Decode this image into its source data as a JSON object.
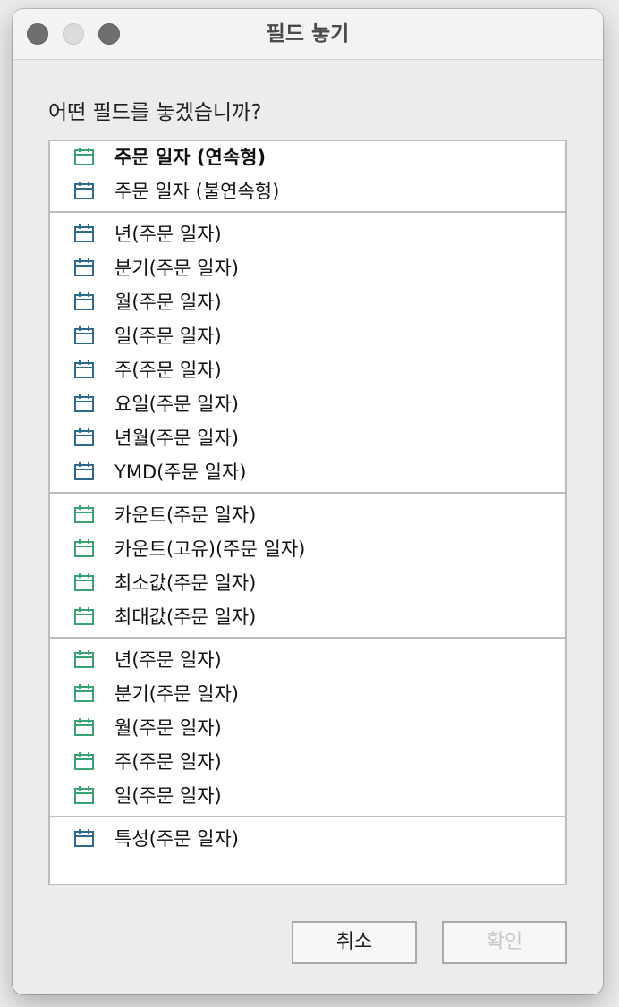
{
  "window": {
    "title": "필드 놓기"
  },
  "prompt": "어떤 필드를 놓겠습니까?",
  "colors": {
    "icon_blue": "#2c6a8e",
    "icon_green": "#3aa374"
  },
  "groups": [
    [
      {
        "label": "주문 일자 (연속형)",
        "icon": "calendar-icon",
        "color": "green",
        "bold": true
      },
      {
        "label": "주문 일자 (불연속형)",
        "icon": "calendar-icon",
        "color": "blue"
      }
    ],
    [
      {
        "label": "년(주문 일자)",
        "icon": "calendar-icon",
        "color": "blue"
      },
      {
        "label": "분기(주문 일자)",
        "icon": "calendar-icon",
        "color": "blue"
      },
      {
        "label": "월(주문 일자)",
        "icon": "calendar-icon",
        "color": "blue"
      },
      {
        "label": "일(주문 일자)",
        "icon": "calendar-icon",
        "color": "blue"
      },
      {
        "label": "주(주문 일자)",
        "icon": "calendar-icon",
        "color": "blue"
      },
      {
        "label": "요일(주문 일자)",
        "icon": "calendar-icon",
        "color": "blue"
      },
      {
        "label": "년월(주문 일자)",
        "icon": "calendar-icon",
        "color": "blue"
      },
      {
        "label": "YMD(주문 일자)",
        "icon": "calendar-icon",
        "color": "blue"
      }
    ],
    [
      {
        "label": "카운트(주문 일자)",
        "icon": "calendar-icon",
        "color": "green"
      },
      {
        "label": "카운트(고유)(주문 일자)",
        "icon": "calendar-icon",
        "color": "green"
      },
      {
        "label": "최소값(주문 일자)",
        "icon": "calendar-icon",
        "color": "green"
      },
      {
        "label": "최대값(주문 일자)",
        "icon": "calendar-icon",
        "color": "green"
      }
    ],
    [
      {
        "label": "년(주문 일자)",
        "icon": "calendar-icon",
        "color": "green"
      },
      {
        "label": "분기(주문 일자)",
        "icon": "calendar-icon",
        "color": "green"
      },
      {
        "label": "월(주문 일자)",
        "icon": "calendar-icon",
        "color": "green"
      },
      {
        "label": "주(주문 일자)",
        "icon": "calendar-icon",
        "color": "green"
      },
      {
        "label": "일(주문 일자)",
        "icon": "calendar-icon",
        "color": "green"
      }
    ],
    [
      {
        "label": "특성(주문 일자)",
        "icon": "calendar-icon",
        "color": "blue"
      }
    ]
  ],
  "buttons": {
    "cancel": "취소",
    "ok": "확인"
  }
}
